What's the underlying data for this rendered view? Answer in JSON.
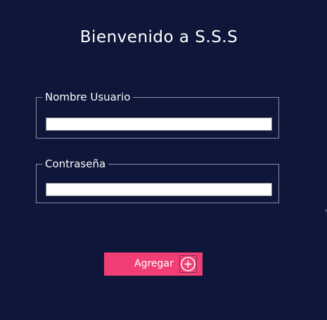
{
  "header": {
    "title": "Bienvenido a S.S.S"
  },
  "form": {
    "username": {
      "legend": "Nombre Usuario",
      "value": ""
    },
    "password": {
      "legend": "Contraseña",
      "value": ""
    }
  },
  "actions": {
    "add_label": "Agregar",
    "add_icon": "plus-circle-icon"
  },
  "colors": {
    "background": "#0e1639",
    "button": "#f13f75",
    "text": "#ffffff",
    "frame_border": "#8a8fa6"
  }
}
